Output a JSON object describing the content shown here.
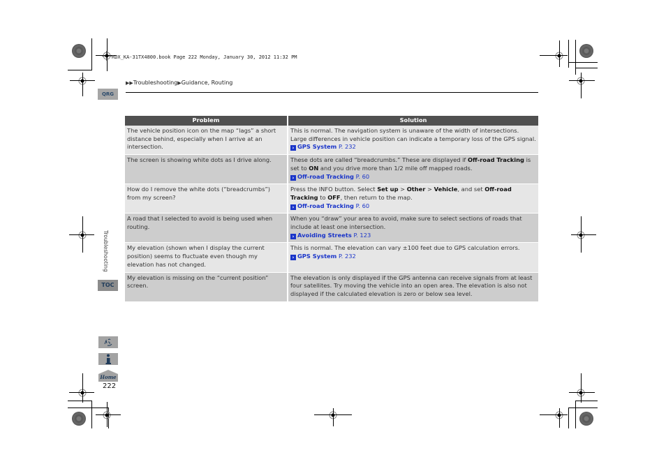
{
  "header": {
    "book_line": "RDX_KA-31TX4800.book  Page 222  Monday, January 30, 2012  11:32 PM",
    "breadcrumb": {
      "arrows": "▶▶",
      "section": "Troubleshooting",
      "separator": "▶",
      "subsection": "Guidance, Routing"
    },
    "qrg_tab": "QRG"
  },
  "table": {
    "columns": [
      "Problem",
      "Solution"
    ],
    "rows": [
      {
        "problem": "The vehicle position icon on the map “lags” a short distance behind, especially when I arrive at an intersection.",
        "solution": "This is normal. The navigation system is unaware of the width of intersections. Large differences in vehicle position can indicate a temporary loss of the GPS signal.",
        "ref": {
          "icon": "arrow-ref-icon",
          "name": "GPS System",
          "page": "P. 232"
        }
      },
      {
        "problem": "The screen is showing white dots as I drive along.",
        "solution_parts": [
          "These dots are called “breadcrumbs.” These are displayed if ",
          "Off-road Tracking",
          " is set to ",
          "ON",
          " and you drive more than 1/2 mile off mapped roads."
        ],
        "ref": {
          "icon": "arrow-ref-icon",
          "name": "Off-road Tracking",
          "page": "P. 60"
        }
      },
      {
        "problem": "How do I remove the white dots (“breadcrumbs”) from my screen?",
        "solution_parts": [
          "Press the INFO button. Select ",
          "Set up",
          " > ",
          "Other",
          " > ",
          "Vehicle",
          ", and set ",
          "Off-road Tracking",
          " to ",
          "OFF",
          ", then return to the map."
        ],
        "ref": {
          "icon": "arrow-ref-icon",
          "name": "Off-road Tracking",
          "page": "P. 60"
        }
      },
      {
        "problem": "A road that I selected to avoid is being used when routing.",
        "solution": "When you “draw” your area to avoid, make sure to select sections of roads that include at least one intersection.",
        "ref": {
          "icon": "arrow-ref-icon",
          "name": "Avoiding Streets",
          "page": "P. 123"
        }
      },
      {
        "problem": "My elevation (shown when I display the current position) seems to fluctuate even though my elevation has not changed.",
        "solution": "This is normal. The elevation can vary ±100 feet due to GPS calculation errors.",
        "ref": {
          "icon": "arrow-ref-icon",
          "name": "GPS System",
          "page": "P. 232"
        }
      },
      {
        "problem": "My elevation is missing on the “current position” screen.",
        "solution": "The elevation is only displayed if the GPS antenna can receive signals from at least four satellites. Try moving the vehicle into an open area. The elevation is also not displayed if the calculated elevation is zero or below sea level."
      }
    ]
  },
  "sidebar": {
    "section_label": "Troubleshooting",
    "toc_tab": "TOC",
    "nav_icons": [
      "voice-command-icon",
      "info-icon",
      "home-icon"
    ],
    "home_label": "Home"
  },
  "footer": {
    "page_number": "222"
  },
  "colors": {
    "header_bg": "#505050",
    "row_light": "#e6e6e6",
    "row_dark": "#cdcdcd",
    "link": "#1a35c9",
    "tab_bg": "#a6a6a6"
  }
}
